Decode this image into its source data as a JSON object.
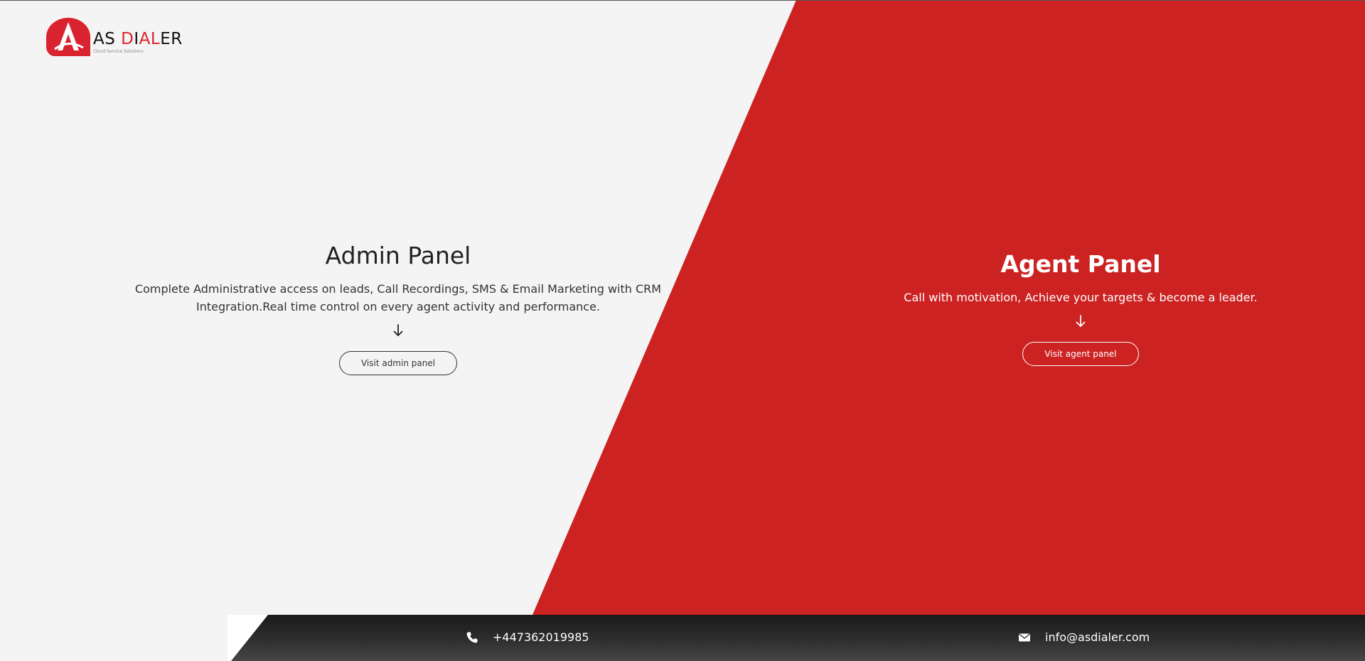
{
  "brand": {
    "name_part1": "AS ",
    "name_part2": "D",
    "name_part3": "I",
    "name_part4": "A",
    "name_part5": "L",
    "name_part6": "ER",
    "tagline": "Cloud Service Solutions",
    "accent_color": "#d9232e"
  },
  "admin_panel": {
    "title": "Admin Panel",
    "description": "Complete Administrative access on leads, Call Recordings, SMS & Email Marketing with CRM Integration.Real time control on every agent activity and performance.",
    "button_label": "Visit admin panel",
    "icon": "arrow-down-icon"
  },
  "agent_panel": {
    "title": "Agent Panel",
    "description": "Call with motivation, Achieve your targets & become a leader.",
    "button_label": "Visit agent panel",
    "icon": "arrow-down-icon",
    "background_color": "#cc2222"
  },
  "footer": {
    "phone": "+447362019985",
    "phone_icon": "phone-icon",
    "email": "info@asdialer.com",
    "email_icon": "envelope-icon"
  }
}
